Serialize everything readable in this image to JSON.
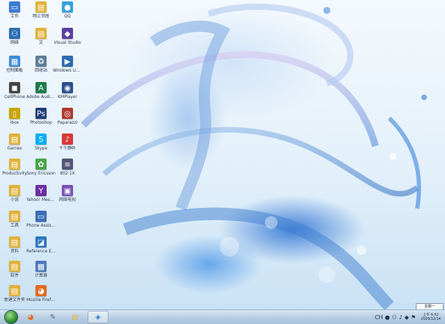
{
  "desktop": {
    "icons": [
      {
        "label": "工作",
        "glyph": "computer-icon",
        "symbol": "▭",
        "color": "#3a7bd5"
      },
      {
        "label": "网上邻居",
        "glyph": "folder-icon",
        "symbol": "▤",
        "color": "#e0b23a"
      },
      {
        "label": "QQ",
        "glyph": "qq-icon",
        "symbol": "●",
        "color": "#33a3dc"
      },
      {
        "label": "网络",
        "glyph": "network-icon",
        "symbol": "⚇",
        "color": "#2c6fb3"
      },
      {
        "label": "文",
        "glyph": "folder-icon",
        "symbol": "▤",
        "color": "#e0b23a"
      },
      {
        "label": "Visual Studio",
        "glyph": "visual-studio-icon",
        "symbol": "◆",
        "color": "#5b3f9e"
      },
      {
        "label": "控制面板",
        "glyph": "control-panel-icon",
        "symbol": "▦",
        "color": "#3c8dd8"
      },
      {
        "label": "回收站",
        "glyph": "recycle-bin-icon",
        "symbol": "♻",
        "color": "#5f7f99"
      },
      {
        "label": "Windows Live Movie",
        "glyph": "movie-icon",
        "symbol": "▶",
        "color": "#2b6cb0"
      },
      {
        "label": "CellPhone",
        "glyph": "phone-icon",
        "symbol": "◼",
        "color": "#444"
      },
      {
        "label": "Adobe Audition",
        "glyph": "audition-icon",
        "symbol": "A",
        "color": "#1d7b4e"
      },
      {
        "label": "KMPlayer",
        "glyph": "kmplayer-icon",
        "symbol": "◉",
        "color": "#2a4f8f"
      },
      {
        "label": "ibox",
        "glyph": "file-icon",
        "symbol": "▯",
        "color": "#c9a400"
      },
      {
        "label": "Photoshop",
        "glyph": "photoshop-icon",
        "symbol": "Ps",
        "color": "#233b78"
      },
      {
        "label": "Paparazzi",
        "glyph": "paparazzi-icon",
        "symbol": "◎",
        "color": "#b03a2e"
      },
      {
        "label": "Games",
        "glyph": "folder-icon",
        "symbol": "▤",
        "color": "#e0b23a"
      },
      {
        "label": "Skype",
        "glyph": "skype-icon",
        "symbol": "S",
        "color": "#00aff0"
      },
      {
        "label": "千千静听",
        "glyph": "player-icon",
        "symbol": "♪",
        "color": "#d93a3a"
      },
      {
        "label": "Productivity",
        "glyph": "folder-icon",
        "symbol": "▤",
        "color": "#e0b23a"
      },
      {
        "label": "Sony Ericsson",
        "glyph": "sony-icon",
        "symbol": "✿",
        "color": "#4aa54a"
      },
      {
        "label": "802 1X",
        "glyph": "network-tool-icon",
        "symbol": "≡",
        "color": "#557"
      },
      {
        "label": "小说",
        "glyph": "folder-icon",
        "symbol": "▤",
        "color": "#e0b23a"
      },
      {
        "label": "Yahoo! Messenger",
        "glyph": "yahoo-icon",
        "symbol": "Y",
        "color": "#6b2fa3"
      },
      {
        "label": "网络电视",
        "glyph": "tv-icon",
        "symbol": "▣",
        "color": "#7a4fb5"
      },
      {
        "label": "工具",
        "glyph": "folder-icon",
        "symbol": "▤",
        "color": "#e0b23a"
      },
      {
        "label": "Phone Assistant",
        "glyph": "phone-assistant-icon",
        "symbol": "▭",
        "color": "#3b6fb5"
      },
      {
        "label": "资料",
        "glyph": "folder-icon",
        "symbol": "▤",
        "color": "#e0b23a"
      },
      {
        "label": "Reference Explorer",
        "glyph": "explorer-icon",
        "symbol": "◪",
        "color": "#2e75c0"
      },
      {
        "label": "软件",
        "glyph": "folder-icon",
        "symbol": "▤",
        "color": "#e0b23a"
      },
      {
        "label": "计算器",
        "glyph": "calculator-icon",
        "symbol": "▦",
        "color": "#4d79b8"
      },
      {
        "label": "新建文件夹",
        "glyph": "folder-icon",
        "symbol": "▤",
        "color": "#e0b23a"
      },
      {
        "label": "Mozilla Firefox",
        "glyph": "firefox-icon",
        "symbol": "◕",
        "color": "#e66a1f"
      }
    ]
  },
  "taskbar": {
    "buttons": [
      {
        "name": "firefox-taskbar-button",
        "symbol": "◕",
        "color": "#e66a1f"
      },
      {
        "name": "tools-taskbar-button",
        "symbol": "✎",
        "color": "#556"
      },
      {
        "name": "explorer-taskbar-button",
        "symbol": "▤",
        "color": "#e0b23a"
      },
      {
        "name": "app-taskbar-button",
        "symbol": "◈",
        "color": "#3477c4"
      }
    ],
    "tray": {
      "lang": "CH",
      "time": "上午 6:52",
      "date": "2009/12/14",
      "tooltip": "星期一"
    }
  },
  "colors": {
    "accent": "#2f6fc1",
    "taskbar": "#b9cfe3"
  }
}
